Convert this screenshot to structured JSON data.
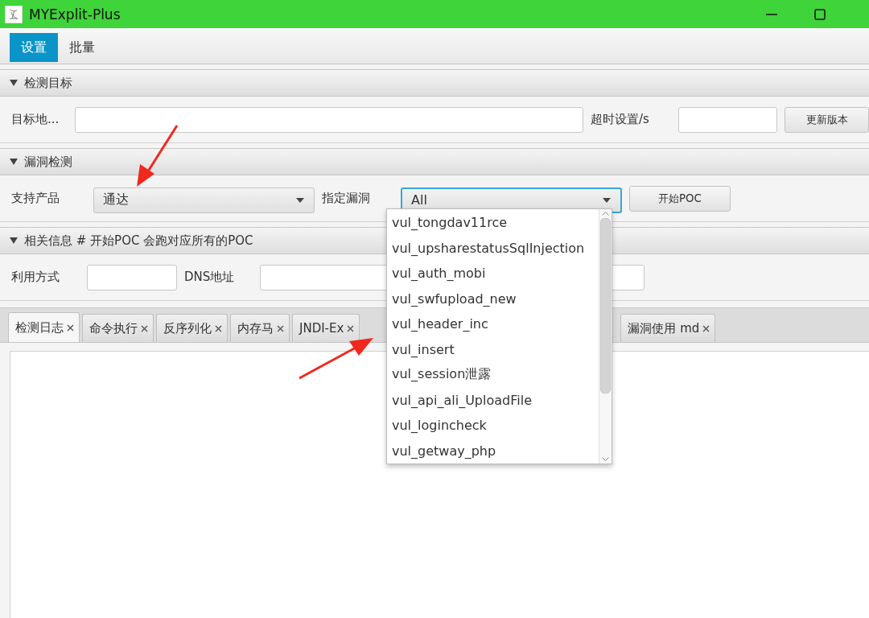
{
  "window": {
    "title": "MYExplit-Plus"
  },
  "menu_tabs": [
    {
      "label": "设置",
      "selected": true
    },
    {
      "label": "批量",
      "selected": false
    }
  ],
  "sections": [
    {
      "title": "检测目标",
      "expanded": true,
      "fields": [
        {
          "kind": "label",
          "text": "目标地..."
        },
        {
          "kind": "input"
        },
        {
          "kind": "label",
          "text": "超时设置/s"
        },
        {
          "kind": "input"
        },
        {
          "kind": "button",
          "text": "更新版本"
        }
      ]
    },
    {
      "title": "漏洞检测",
      "expanded": true,
      "fields": [
        {
          "kind": "label",
          "text": "支持产品"
        },
        {
          "kind": "combo",
          "value": "通达",
          "focused": false
        },
        {
          "kind": "label",
          "text": "指定漏洞"
        },
        {
          "kind": "combo",
          "value": "All",
          "focused": true
        },
        {
          "kind": "button",
          "text": "开始POC"
        }
      ]
    },
    {
      "title": "相关信息 # 开始POC 会跑对应所有的POC",
      "expanded": true,
      "fields": [
        {
          "kind": "label",
          "text": "利用方式"
        },
        {
          "kind": "input"
        },
        {
          "kind": "label",
          "text": "DNS地址"
        },
        {
          "kind": "input"
        }
      ]
    }
  ],
  "detail_tabs": [
    {
      "label": "检测日志",
      "selected": true
    },
    {
      "label": "命令执行",
      "selected": false
    },
    {
      "label": "反序列化",
      "selected": false
    },
    {
      "label": "内存马",
      "selected": false
    },
    {
      "label": "JNDI-Ex",
      "selected": false
    },
    {
      "label": "漏洞使用 md",
      "selected": false
    }
  ],
  "dropdown": {
    "items": [
      "vul_tongdav11rce",
      "vul_upsharestatusSqlInjection",
      "vul_auth_mobi",
      "vul_swfupload_new",
      "vul_header_inc",
      "vul_insert",
      "vul_session泄露",
      "vul_api_ali_UploadFile",
      "vul_logincheck",
      "vul_getway_php"
    ]
  }
}
